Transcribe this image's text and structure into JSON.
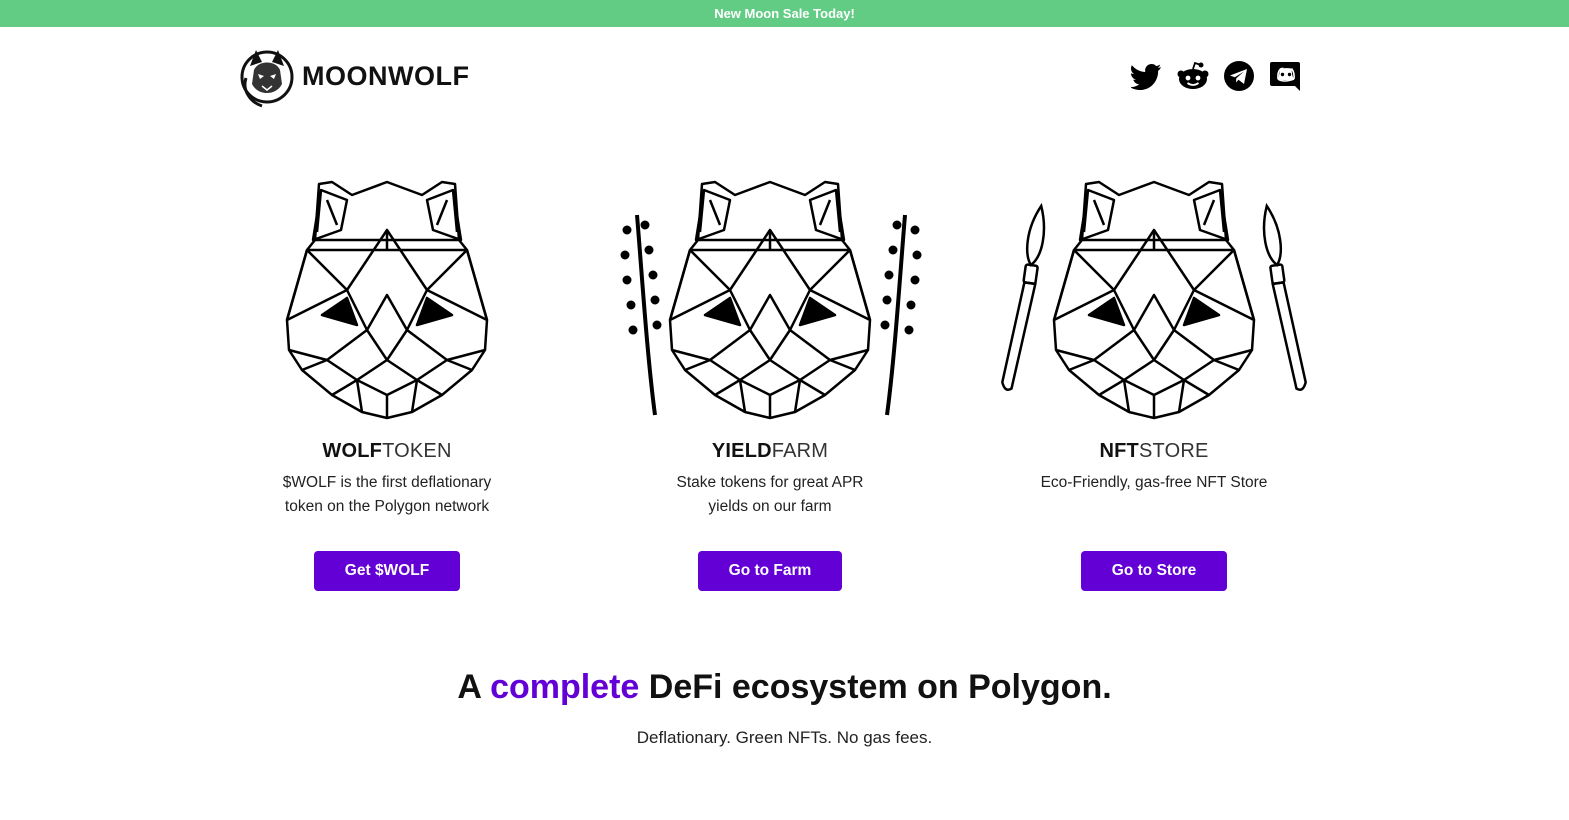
{
  "banner": {
    "text": "New Moon Sale Today!"
  },
  "brand": {
    "name": "MOONWOLF",
    "logo": "wolf-logo"
  },
  "socials": [
    {
      "name": "twitter",
      "icon": "twitter-icon"
    },
    {
      "name": "reddit",
      "icon": "reddit-icon"
    },
    {
      "name": "telegram",
      "icon": "telegram-icon"
    },
    {
      "name": "discord",
      "icon": "discord-icon"
    }
  ],
  "features": [
    {
      "title_bold": "WOLF",
      "title_light": "TOKEN",
      "description": "$WOLF is the first deflationary token on the Polygon network",
      "button": "Get $WOLF",
      "art": "geometric-wolf-head"
    },
    {
      "title_bold": "YIELD",
      "title_light": "FARM",
      "description": "Stake tokens for great APR yields on our farm",
      "button": "Go to Farm",
      "art": "geometric-wolf-head-with-plants"
    },
    {
      "title_bold": "NFT",
      "title_light": "STORE",
      "description": "Eco-Friendly, gas-free NFT Store",
      "button": "Go to Store",
      "art": "geometric-wolf-head-with-brushes"
    }
  ],
  "tagline": {
    "prefix": "A ",
    "accent": "complete",
    "suffix": " DeFi ecosystem on Polygon."
  },
  "subtagline": "Deflationary. Green NFTs. No gas fees.",
  "colors": {
    "banner": "#62cb84",
    "accent": "#6200d6",
    "text": "#111111"
  }
}
